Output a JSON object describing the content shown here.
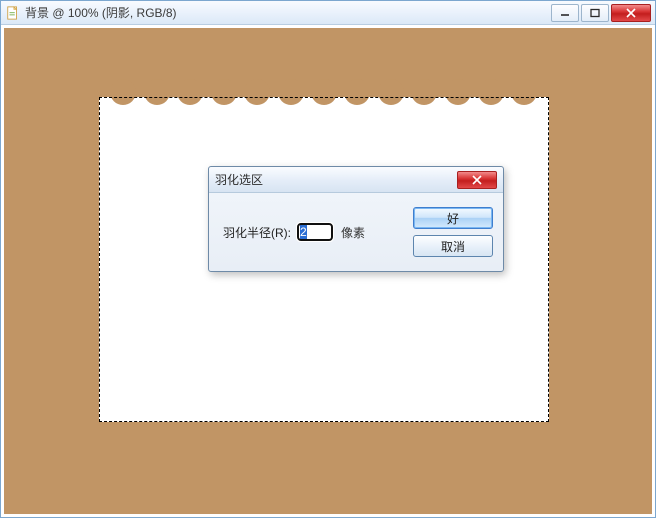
{
  "window": {
    "title": "背景 @ 100% (阴影, RGB/8)"
  },
  "dialog": {
    "title": "羽化选区",
    "radius_label": "羽化半径(R):",
    "radius_value": "2",
    "pixel_label": "像素",
    "ok_label": "好",
    "cancel_label": "取消"
  },
  "colors": {
    "canvas_bg": "#c19565"
  }
}
